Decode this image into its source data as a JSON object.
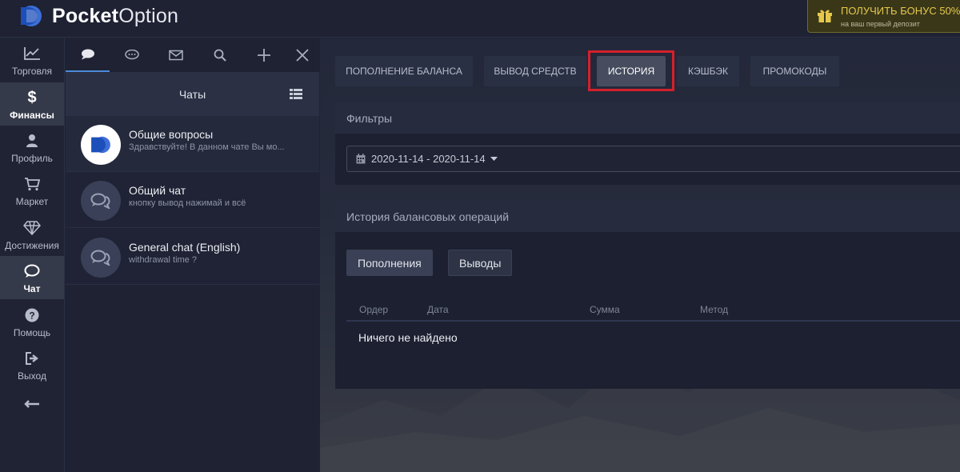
{
  "header": {
    "logo_bold": "Pocket",
    "logo_light": "Option",
    "bonus_title": "ПОЛУЧИТЬ БОНУС 50%",
    "bonus_subtitle": "на ваш первый депозит"
  },
  "leftnav": {
    "items": [
      {
        "label": "Торговля",
        "icon": "chart-icon"
      },
      {
        "label": "Финансы",
        "icon": "dollar-icon",
        "active": true
      },
      {
        "label": "Профиль",
        "icon": "user-icon"
      },
      {
        "label": "Маркет",
        "icon": "cart-icon"
      },
      {
        "label": "Достижения",
        "icon": "diamond-icon"
      },
      {
        "label": "Чат",
        "icon": "chat-icon",
        "active": true
      },
      {
        "label": "Помощь",
        "icon": "help-icon"
      },
      {
        "label": "Выход",
        "icon": "logout-icon"
      }
    ],
    "collapse_icon": "arrow-left-icon"
  },
  "chat": {
    "title": "Чаты",
    "items": [
      {
        "name": "Общие вопросы",
        "message": "Здравствуйте! В данном чате Вы мо..."
      },
      {
        "name": "Общий чат",
        "message": "кнопку вывод нажимай и всё"
      },
      {
        "name": "General chat (English)",
        "message": "withdrawal time ?"
      }
    ]
  },
  "main": {
    "tabs": [
      {
        "label": "ПОПОЛНЕНИЕ БАЛАНСА"
      },
      {
        "label": "ВЫВОД СРЕДСТВ"
      },
      {
        "label": "ИСТОРИЯ",
        "active": true
      },
      {
        "label": "КЭШБЭК"
      },
      {
        "label": "ПРОМОКОДЫ"
      }
    ],
    "filters_title": "Фильтры",
    "date_range": "2020-11-14 - 2020-11-14",
    "history_title": "История балансовых операций",
    "buttons": {
      "deposits": "Пополнения",
      "withdrawals": "Выводы"
    },
    "columns": [
      "Ордер",
      "Дата",
      "Сумма",
      "Метод"
    ],
    "empty_text": "Ничего не найдено"
  },
  "colors": {
    "accent": "#4d8ad8",
    "highlight": "#d4202b",
    "bonus": "#e6c84a"
  }
}
